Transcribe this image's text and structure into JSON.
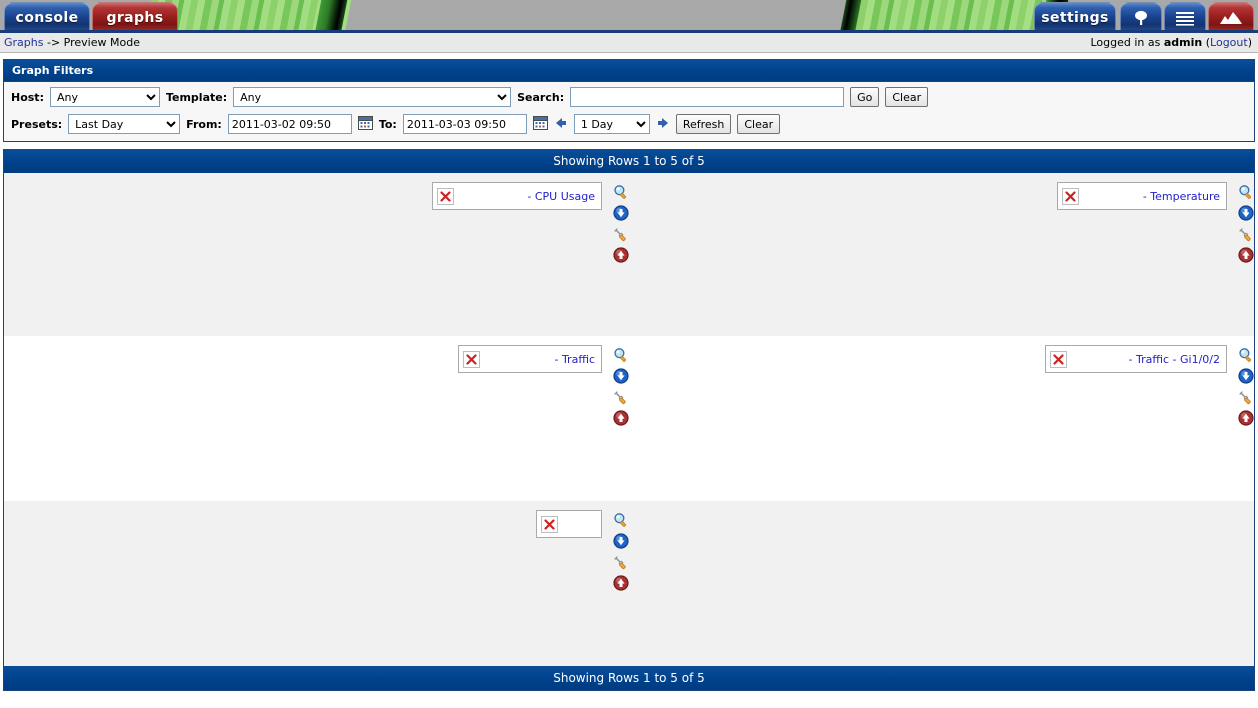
{
  "banner": {
    "tabs": [
      {
        "id": "console",
        "label": "console",
        "style": "blue"
      },
      {
        "id": "graphs",
        "label": "graphs",
        "style": "red"
      },
      {
        "id": "settings",
        "label": "settings",
        "style": "blue"
      },
      {
        "id": "tree-view",
        "label": "",
        "icon": "tree-icon",
        "style": "blue"
      },
      {
        "id": "list-view",
        "label": "",
        "icon": "list-icon",
        "style": "blue"
      },
      {
        "id": "preview-view",
        "label": "",
        "icon": "graph-icon",
        "style": "red"
      }
    ]
  },
  "breadcrumb": {
    "link": "Graphs",
    "separator": "->",
    "current": "Preview Mode"
  },
  "login": {
    "prefix": "Logged in as",
    "user": "admin",
    "logout_open": "(",
    "logout": "Logout",
    "logout_close": ")"
  },
  "filters": {
    "title": "Graph Filters",
    "host_label": "Host:",
    "host_value": "Any",
    "template_label": "Template:",
    "template_value": "Any",
    "search_label": "Search:",
    "search_value": "",
    "search_placeholder": "",
    "go_label": "Go",
    "clear_label": "Clear",
    "presets_label": "Presets:",
    "presets_value": "Last Day",
    "from_label": "From:",
    "from_value": "2011-03-02 09:50",
    "to_label": "To:",
    "to_value": "2011-03-03 09:50",
    "span_value": "1 Day",
    "refresh_label": "Refresh",
    "clear2_label": "Clear"
  },
  "results": {
    "top_status": "Showing Rows 1 to 5 of 5",
    "bottom_status": "Showing Rows 1 to 5 of 5",
    "graphs": [
      {
        "caption": "- CPU Usage"
      },
      {
        "caption": "- Temperature"
      },
      {
        "caption": "- Traffic"
      },
      {
        "caption": "- Traffic - Gi1/0/2"
      },
      {
        "caption": ""
      }
    ],
    "icons": [
      {
        "name": "zoom-icon",
        "title": "Zoom Graph"
      },
      {
        "name": "csv-export-icon",
        "title": "CSV Export"
      },
      {
        "name": "graph-properties-icon",
        "title": "Graph Properties"
      },
      {
        "name": "page-top-icon",
        "title": "Page Top"
      }
    ]
  },
  "colors": {
    "header_blue": "#00428c",
    "tab_blue": "#1a4490",
    "tab_red": "#9c1f1f",
    "link_blue": "#2222cc",
    "row_shade": "#f1f1f1"
  }
}
